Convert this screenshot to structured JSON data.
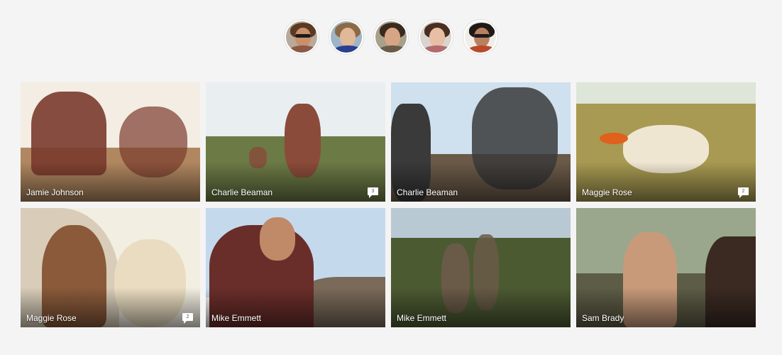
{
  "avatars": [
    {
      "label": "avatar-1",
      "skin": "#c98f6a",
      "hair": "#5b3a22",
      "shirt": "#8a5a46",
      "shades": true,
      "bg": "#b8a99a"
    },
    {
      "label": "avatar-2",
      "skin": "#e1b89a",
      "hair": "#8b6a45",
      "shirt": "#2a3f8f",
      "shades": false,
      "bg": "#9fb5c6"
    },
    {
      "label": "avatar-3",
      "skin": "#d6a585",
      "hair": "#3a2a1e",
      "shirt": "#6b5a4a",
      "shades": false,
      "bg": "#a7a08a"
    },
    {
      "label": "avatar-4",
      "skin": "#e6bfa4",
      "hair": "#4a2e20",
      "shirt": "#b36b6b",
      "shades": false,
      "bg": "#d9d4cf"
    },
    {
      "label": "avatar-5",
      "skin": "#b9805f",
      "hair": "#1e1a18",
      "shirt": "#b84b2c",
      "shades": true,
      "bg": "#f0ede8"
    }
  ],
  "photos": [
    {
      "name": "Jamie Johnson",
      "comments": null,
      "sky": "#f3ede3",
      "ground": "#b08760",
      "accent": "#7a3a2c"
    },
    {
      "name": "Charlie Beaman",
      "comments": "3",
      "sky": "#e9eef0",
      "ground": "#6c7a45",
      "accent": "#8a4b3a"
    },
    {
      "name": "Charlie Beaman",
      "comments": null,
      "sky": "#cfe0ef",
      "ground": "#6b5a48",
      "accent": "#3a3a3a"
    },
    {
      "name": "Maggie Rose",
      "comments": "2",
      "sky": "#dde6d8",
      "ground": "#a89a52",
      "accent": "#efe6d2"
    },
    {
      "name": "Maggie Rose",
      "comments": "2",
      "sky": "#f2eee2",
      "ground": "#c8b89e",
      "accent": "#e9dcc0"
    },
    {
      "name": "Mike Emmett",
      "comments": null,
      "sky": "#c5d9ec",
      "ground": "#7a6a5a",
      "accent": "#6a2e2a"
    },
    {
      "name": "Mike Emmett",
      "comments": null,
      "sky": "#b9c9d4",
      "ground": "#4c5a32",
      "accent": "#6a5a48"
    },
    {
      "name": "Sam Brady",
      "comments": null,
      "sky": "#9aa78c",
      "ground": "#4e4a34",
      "accent": "#c89a7a"
    }
  ]
}
